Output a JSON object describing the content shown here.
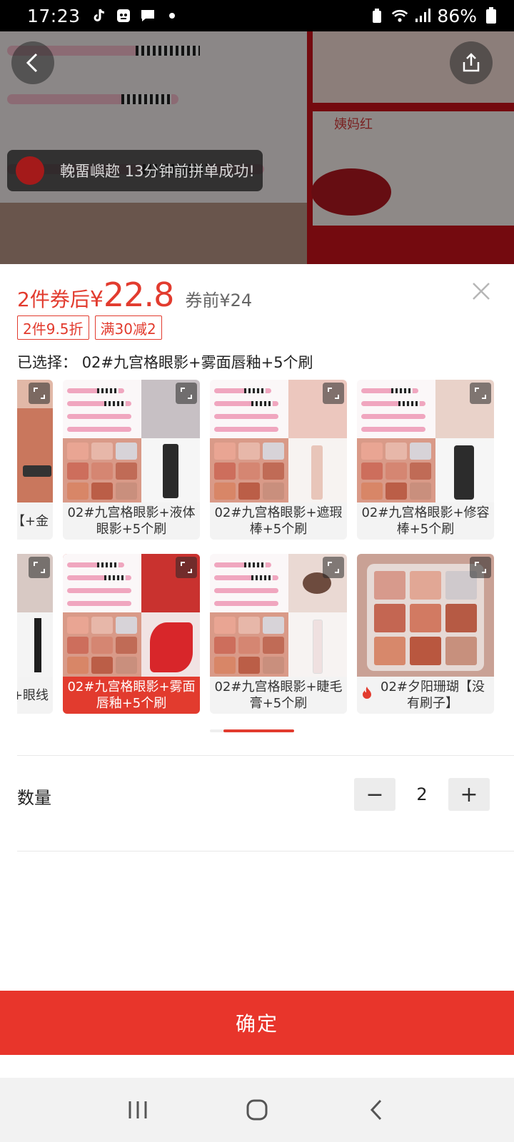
{
  "status_bar": {
    "time": "17:23",
    "battery": "86%",
    "icons": [
      "tiktok-icon",
      "face-icon",
      "chat-icon",
      "dot-icon",
      "recycle-icon",
      "wifi-icon",
      "signal-icon",
      "battery-icon"
    ]
  },
  "background": {
    "toast_text": "輓畱嶼趂 13分钟前拼单成功!",
    "product_tag": "姨妈红"
  },
  "sheet": {
    "price_prefix": "2件券后",
    "price_currency": "¥",
    "price_value": "22.8",
    "original_price": "券前¥24",
    "badges": [
      "2件9.5折",
      "满30减2"
    ],
    "selected_label": "已选择：",
    "selected_value": "02#九宫格眼影+雾面唇釉+5个刷",
    "variants_row1": [
      {
        "caption": "【+金"
      },
      {
        "caption": "02#九宫格眼影+液体眼影+5个刷"
      },
      {
        "caption": "02#九宫格眼影+遮瑕棒+5个刷"
      },
      {
        "caption": "02#九宫格眼影+修容棒+5个刷"
      }
    ],
    "variants_row2": [
      {
        "caption": "+眼线"
      },
      {
        "caption": "02#九宫格眼影+雾面唇釉+5个刷"
      },
      {
        "caption": "02#九宫格眼影+睫毛膏+5个刷"
      },
      {
        "caption": "02#夕阳珊瑚【没有刷子】"
      }
    ],
    "quantity_label": "数量",
    "quantity_value": "2",
    "minus_label": "−",
    "plus_label": "+",
    "confirm_label": "确定"
  },
  "colors": {
    "accent": "#e23b2e",
    "confirm_bg": "#e8352b"
  }
}
